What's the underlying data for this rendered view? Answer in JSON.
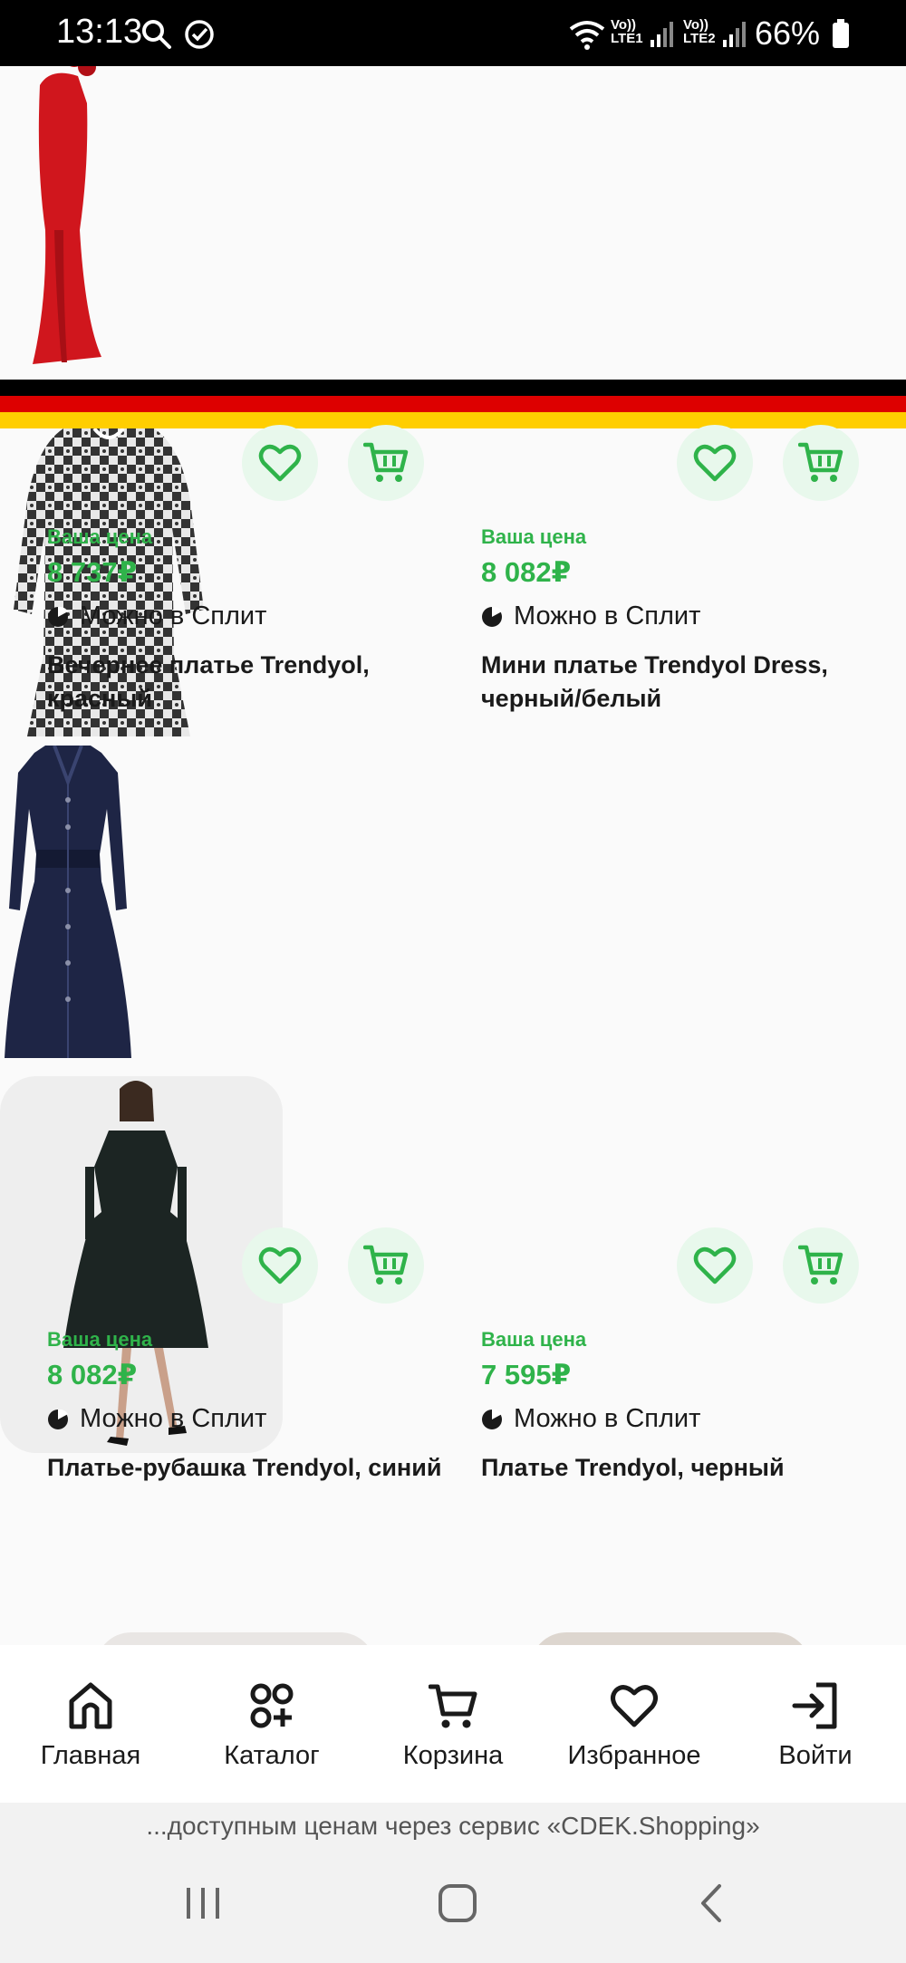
{
  "status_bar": {
    "time": "13:13",
    "sim1": "Vo))\nLTE1",
    "sim2": "Vo))\nLTE2",
    "battery": "66%"
  },
  "products": [
    {
      "price_label": "Ваша цена",
      "price": "8 737₽",
      "split_label": "Можно в Сплит",
      "title": "Вечернее платье Trendyol, красный",
      "flag": "germany-flag",
      "image": "red-evening-dress"
    },
    {
      "price_label": "Ваша цена",
      "price": "8 082₽",
      "split_label": "Можно в Сплит",
      "title": "Мини платье Trendyol Dress, черный/белый",
      "flag": "germany-flag",
      "image": "patterned-mini-dress"
    },
    {
      "price_label": "Ваша цена",
      "price": "8 082₽",
      "split_label": "Можно в Сплит",
      "title": "Платье-рубашка Trendyol, синий",
      "flag": "germany-flag",
      "image": "denim-shirt-dress"
    },
    {
      "price_label": "Ваша цена",
      "price": "7 595₽",
      "split_label": "Можно в Сплит",
      "title": "Платье Trendyol, черный",
      "flag": "germany-flag",
      "image": "black-midi-dress-model"
    }
  ],
  "bottom_nav": [
    {
      "label": "Главная",
      "icon": "home-icon"
    },
    {
      "label": "Каталог",
      "icon": "catalog-icon"
    },
    {
      "label": "Корзина",
      "icon": "cart-icon"
    },
    {
      "label": "Избранное",
      "icon": "heart-icon"
    },
    {
      "label": "Войти",
      "icon": "login-icon"
    }
  ],
  "promo_banner": "...доступным ценам через сервис «CDEK.Shopping»",
  "colors": {
    "accent_green": "#2fb34a",
    "button_bg": "#e8f8ec"
  }
}
